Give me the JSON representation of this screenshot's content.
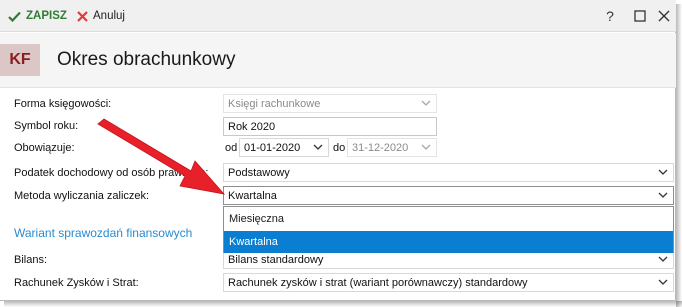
{
  "toolbar": {
    "save_label": "ZAPISZ",
    "cancel_label": "Anuluj",
    "save_color": "#2e7d32",
    "cancel_color": "#e53935"
  },
  "window_controls": {
    "help": "?",
    "maximize": "☐",
    "close": "✕"
  },
  "header": {
    "badge": "KF",
    "title": "Okres obrachunkowy"
  },
  "form": {
    "forma_label": "Forma księgowości:",
    "forma_value": "Księgi rachunkowe",
    "symbol_label": "Symbol roku:",
    "symbol_value": "Rok 2020",
    "obowiazuje_label": "Obowiązuje:",
    "od_label": "od",
    "od_value": "01-01-2020",
    "do_label": "do",
    "do_value": "31-12-2020",
    "podatek_label": "Podatek dochodowy od osób prawnych:",
    "podatek_value": "Podstawowy",
    "metoda_label": "Metoda wyliczania zaliczek:",
    "metoda_value": "Kwartalna",
    "section_title": "Wariant sprawozdań finansowych",
    "bilans_label": "Bilans:",
    "bilans_value": "Bilans standardowy",
    "rzis_label": "Rachunek Zysków i Strat:",
    "rzis_value": "Rachunek zysków i strat (wariant porównawczy) standardowy"
  },
  "dropdown": {
    "options": [
      "Miesięczna",
      "Kwartalna"
    ],
    "selected": "Kwartalna",
    "highlight_color": "#0a7fd1"
  },
  "annotation_color": "#e8202a"
}
